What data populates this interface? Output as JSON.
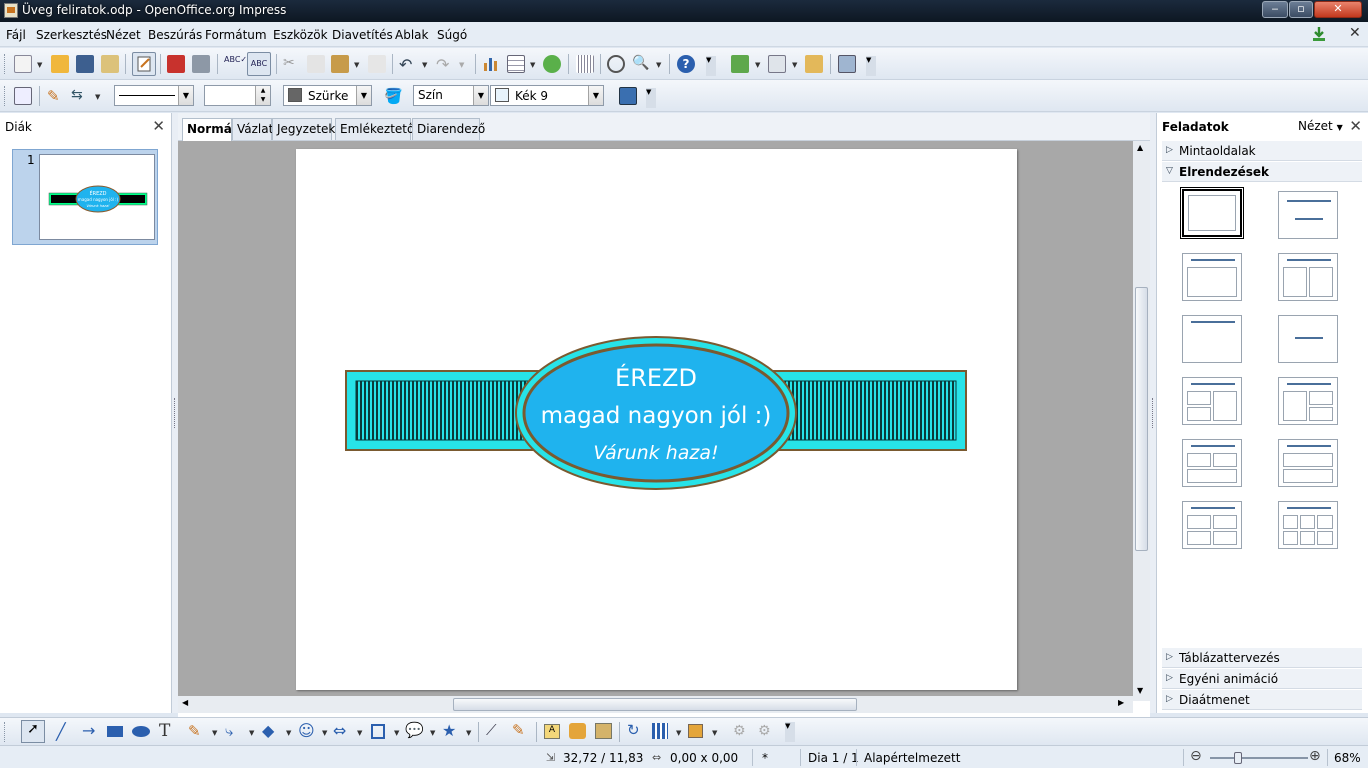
{
  "window": {
    "title": "Üveg feliratok.odp - OpenOffice.org Impress"
  },
  "menu": [
    "Fájl",
    "Szerkesztés",
    "Nézet",
    "Beszúrás",
    "Formátum",
    "Eszközök",
    "Diavetítés",
    "Ablak",
    "Súgó"
  ],
  "line_toolbar": {
    "area_style_label": "Szürke",
    "area_fill_type": "Szín",
    "area_color_label": "Kék 9"
  },
  "slides_pane": {
    "title": "Diák",
    "slide_number": "1"
  },
  "view_tabs": [
    "Normál",
    "Vázlat",
    "Jegyzetek",
    "Emlékeztető",
    "Diarendező"
  ],
  "slide": {
    "line1": "ÉREZD",
    "line2": "magad nagyon jól :)",
    "line3": "Várunk haza!",
    "colors": {
      "band": "#27e3e8",
      "ellipse": "#1fb3ee",
      "border": "#8a5a2b"
    }
  },
  "task_pane": {
    "title": "Feladatok",
    "view_label": "Nézet",
    "sections_top": [
      "Mintaoldalak",
      "Elrendezések"
    ],
    "sections_bottom": [
      "Táblázattervezés",
      "Egyéni animáció",
      "Diaátmenet"
    ]
  },
  "status": {
    "position": "32,72 / 11,83",
    "size": "0,00 x 0,00",
    "modified": "*",
    "slide": "Dia 1 / 1",
    "master": "Alapértelmezett",
    "zoom": "68%"
  }
}
